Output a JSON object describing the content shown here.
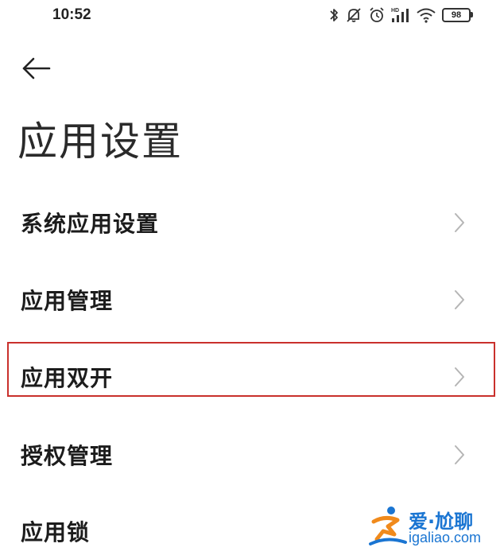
{
  "status_bar": {
    "time": "10:52",
    "battery_level": "98",
    "icons": [
      "bluetooth-icon",
      "mute-bell-icon",
      "alarm-icon",
      "hd-signal-icon",
      "wifi-icon",
      "battery-icon"
    ]
  },
  "header": {
    "back_icon": "back-arrow-icon",
    "title": "应用设置"
  },
  "menu": {
    "items": [
      {
        "label": "系统应用设置",
        "icon": "chevron-right-icon"
      },
      {
        "label": "应用管理",
        "icon": "chevron-right-icon"
      },
      {
        "label": "应用双开",
        "icon": "chevron-right-icon",
        "highlighted": true
      },
      {
        "label": "授权管理",
        "icon": "chevron-right-icon"
      },
      {
        "label": "应用锁",
        "icon": "chevron-right-icon"
      }
    ]
  },
  "watermark": {
    "line1": "爱·尬聊",
    "line2": "igaliao.com"
  },
  "colors": {
    "highlight_border": "#c9302c",
    "chevron": "#b5b5b5",
    "watermark_blue": "#1a75d2",
    "watermark_orange": "#f08a1c"
  }
}
